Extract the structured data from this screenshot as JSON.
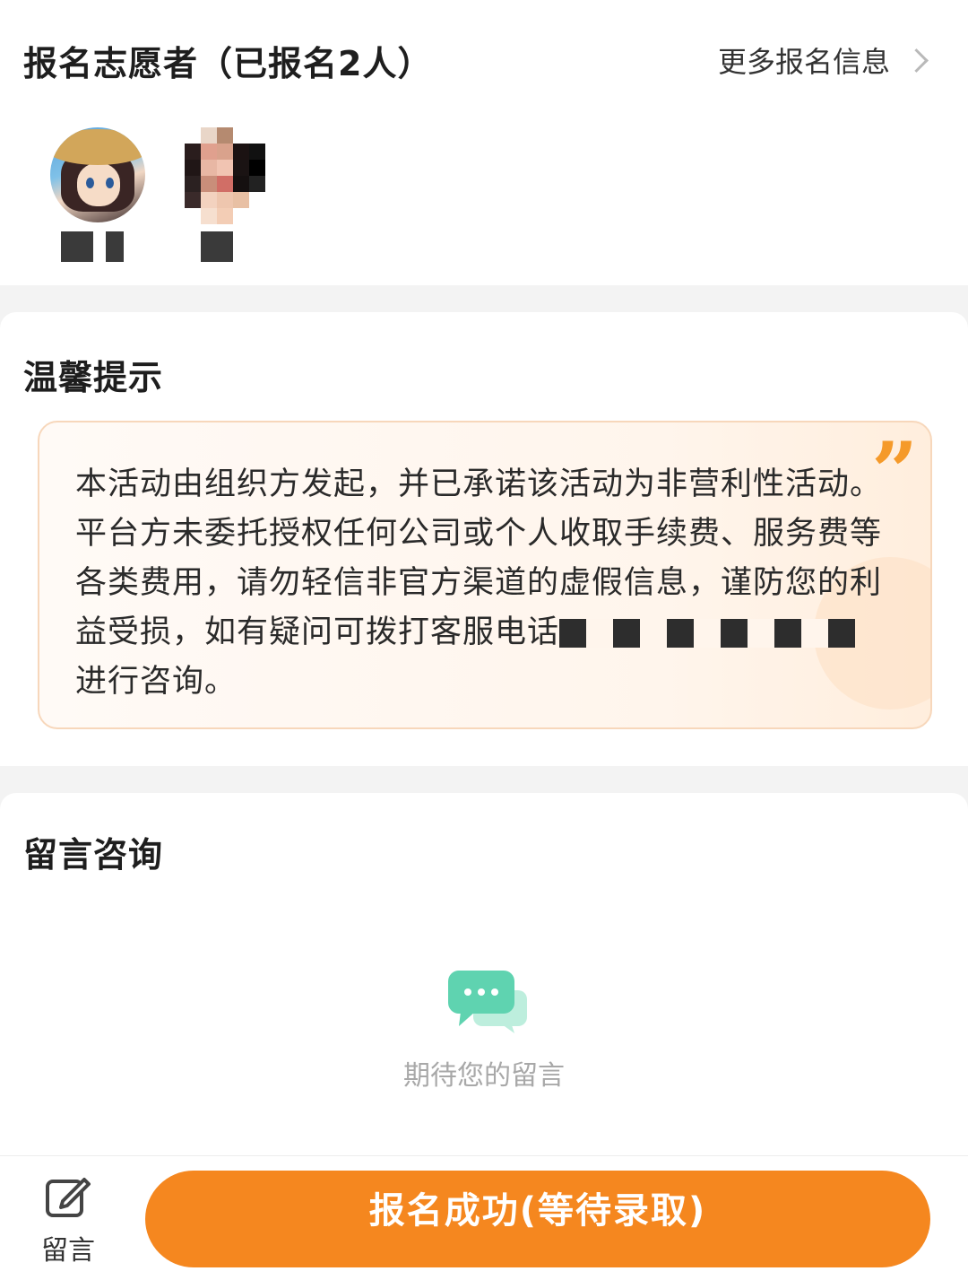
{
  "volunteers": {
    "title": "报名志愿者（已报名2人）",
    "more_label": "更多报名信息"
  },
  "tips": {
    "title": "温馨提示",
    "text_main": "本活动由组织方发起，并已承诺该活动为非营利性活动。平台方未委托授权任何公司或个人收取手续费、服务费等各类费用，请勿轻信非官方渠道的虚假信息，谨防您的利益受损，如有疑问可拨打客服电话",
    "text_tail": "进行咨询。",
    "quote_mark": "”"
  },
  "messages": {
    "title": "留言咨询",
    "empty_text": "期待您的留言"
  },
  "bottom": {
    "message_label": "留言",
    "apply_label": "报名成功(等待录取)"
  },
  "colors": {
    "accent": "#f5871f",
    "tip_border": "#f7d7bb",
    "chat_icon": "#5fd3b0"
  }
}
